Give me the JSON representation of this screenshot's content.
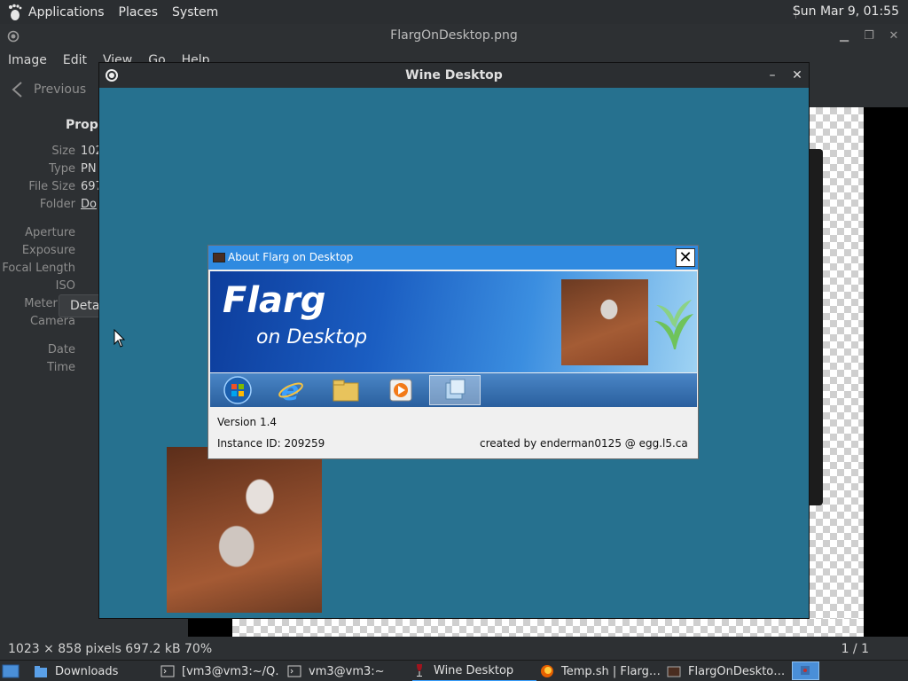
{
  "top_panel": {
    "menus": [
      "Applications",
      "Places",
      "System"
    ],
    "clock": "Sun Mar  9, 01:55"
  },
  "viewer": {
    "title": "FlargOnDesktop.png",
    "menus": [
      "Image",
      "Edit",
      "View",
      "Go",
      "Help"
    ],
    "previous_label": "Previous",
    "properties_heading": "Prope",
    "properties": [
      {
        "label": "Size",
        "value": "102"
      },
      {
        "label": "Type",
        "value": "PN"
      },
      {
        "label": "File Size",
        "value": "697"
      },
      {
        "label": "Folder",
        "value": "Do"
      },
      {
        "label": "Aperture",
        "value": ""
      },
      {
        "label": "Exposure",
        "value": ""
      },
      {
        "label": "Focal Length",
        "value": ""
      },
      {
        "label": "ISO",
        "value": ""
      },
      {
        "label": "Metering",
        "value": ""
      },
      {
        "label": "Camera",
        "value": ""
      },
      {
        "label": "Date",
        "value": ""
      },
      {
        "label": "Time",
        "value": ""
      }
    ],
    "details_label": "Detai",
    "status_left": "1023 × 858 pixels  697.2 kB   70%",
    "status_right": "1 / 1"
  },
  "wine": {
    "title": "Wine Desktop",
    "minimize": "–",
    "close": "✕"
  },
  "about": {
    "title": "About Flarg on Desktop",
    "close": "✕",
    "banner_title": "Flarg",
    "banner_subtitle": "on Desktop",
    "version": "Version 1.4",
    "instance": "Instance ID:  209259",
    "credit": "created by enderman0125 @ egg.l5.ca"
  },
  "taskbar": {
    "items": [
      "Downloads",
      "[vm3@vm3:~/Q…",
      "vm3@vm3:~",
      "Wine Desktop",
      "Temp.sh | Flarg…",
      "FlargOnDeskto…"
    ]
  },
  "colors": {
    "wine_desktop_bg": "#26718f",
    "about_titlebar": "#2f8ae0",
    "panel_bg": "#2b2e31"
  }
}
